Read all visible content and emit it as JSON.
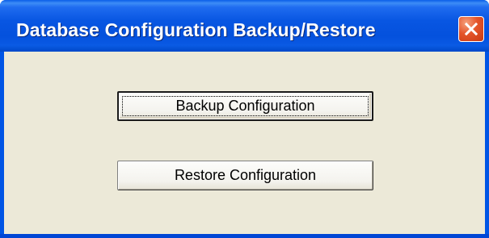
{
  "window": {
    "title": "Database Configuration Backup/Restore"
  },
  "titlebar_controls": {
    "close_icon": "close-x-icon"
  },
  "buttons": {
    "backup_label": "Backup Configuration",
    "restore_label": "Restore Configuration"
  },
  "colors": {
    "titlebar": "#0055e5",
    "close_button": "#e4542a",
    "client_background": "#ece9d8"
  }
}
